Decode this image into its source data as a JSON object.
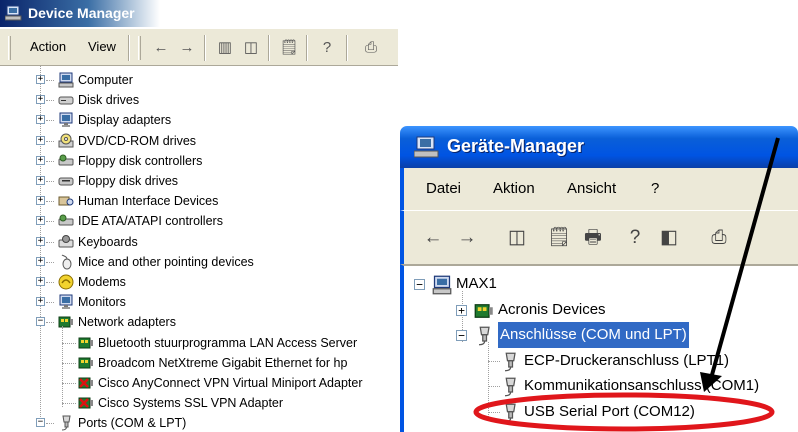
{
  "en": {
    "title": "Device Manager",
    "menu": {
      "action": "Action",
      "view": "View"
    },
    "tree": [
      {
        "label": "Computer",
        "icon": "computer-icon",
        "state": "+"
      },
      {
        "label": "Disk drives",
        "icon": "disk-drive-icon",
        "state": "+"
      },
      {
        "label": "Display adapters",
        "icon": "monitor-icon",
        "state": "+"
      },
      {
        "label": "DVD/CD-ROM drives",
        "icon": "cdrom-icon",
        "state": "+"
      },
      {
        "label": "Floppy disk controllers",
        "icon": "controller-icon",
        "state": "+"
      },
      {
        "label": "Floppy disk drives",
        "icon": "floppy-icon",
        "state": "+"
      },
      {
        "label": "Human Interface Devices",
        "icon": "hid-icon",
        "state": "+"
      },
      {
        "label": "IDE ATA/ATAPI controllers",
        "icon": "controller-icon",
        "state": "+"
      },
      {
        "label": "Keyboards",
        "icon": "keyboard-icon",
        "state": "+"
      },
      {
        "label": "Mice and other pointing devices",
        "icon": "mouse-icon",
        "state": "+"
      },
      {
        "label": "Modems",
        "icon": "modem-icon",
        "state": "+"
      },
      {
        "label": "Monitors",
        "icon": "monitor-icon",
        "state": "+"
      },
      {
        "label": "Network adapters",
        "icon": "network-card-icon",
        "state": "-"
      },
      {
        "label": "Bluetooth stuurprogramma LAN Access Server",
        "icon": "network-card-icon",
        "child": true
      },
      {
        "label": "Broadcom NetXtreme Gigabit Ethernet for hp",
        "icon": "network-card-icon",
        "child": true
      },
      {
        "label": "Cisco AnyConnect VPN Virtual Miniport Adapter",
        "icon": "network-card-error-icon",
        "child": true
      },
      {
        "label": "Cisco Systems SSL VPN Adapter",
        "icon": "network-card-error-icon",
        "child": true
      },
      {
        "label": "Ports (COM & LPT)",
        "icon": "port-icon",
        "state": "-"
      }
    ]
  },
  "de": {
    "title": "Geräte-Manager",
    "menu": [
      "Datei",
      "Aktion",
      "Ansicht",
      "?"
    ],
    "tree": [
      {
        "label": "MAX1",
        "icon": "computer-icon",
        "state": "-"
      },
      {
        "label": "Acronis Devices",
        "icon": "network-card-icon",
        "state": "+"
      },
      {
        "label": "Anschlüsse (COM und LPT)",
        "icon": "port-icon",
        "state": "-",
        "selected": true
      },
      {
        "label": "ECP-Druckeranschluss (LPT1)",
        "icon": "port-icon",
        "child": true
      },
      {
        "label": "Kommunikationsanschluss (COM1)",
        "icon": "port-icon",
        "child": true
      },
      {
        "label": "USB Serial Port (COM12)",
        "icon": "port-icon",
        "child": true,
        "highlighted": true
      }
    ]
  },
  "annotation": {
    "color": "#e0161b",
    "arrow_color": "#000000"
  },
  "colors": {
    "selection": "#316ac5",
    "xp_blue": "#0054e3",
    "toolbar": "#ece9d8"
  }
}
